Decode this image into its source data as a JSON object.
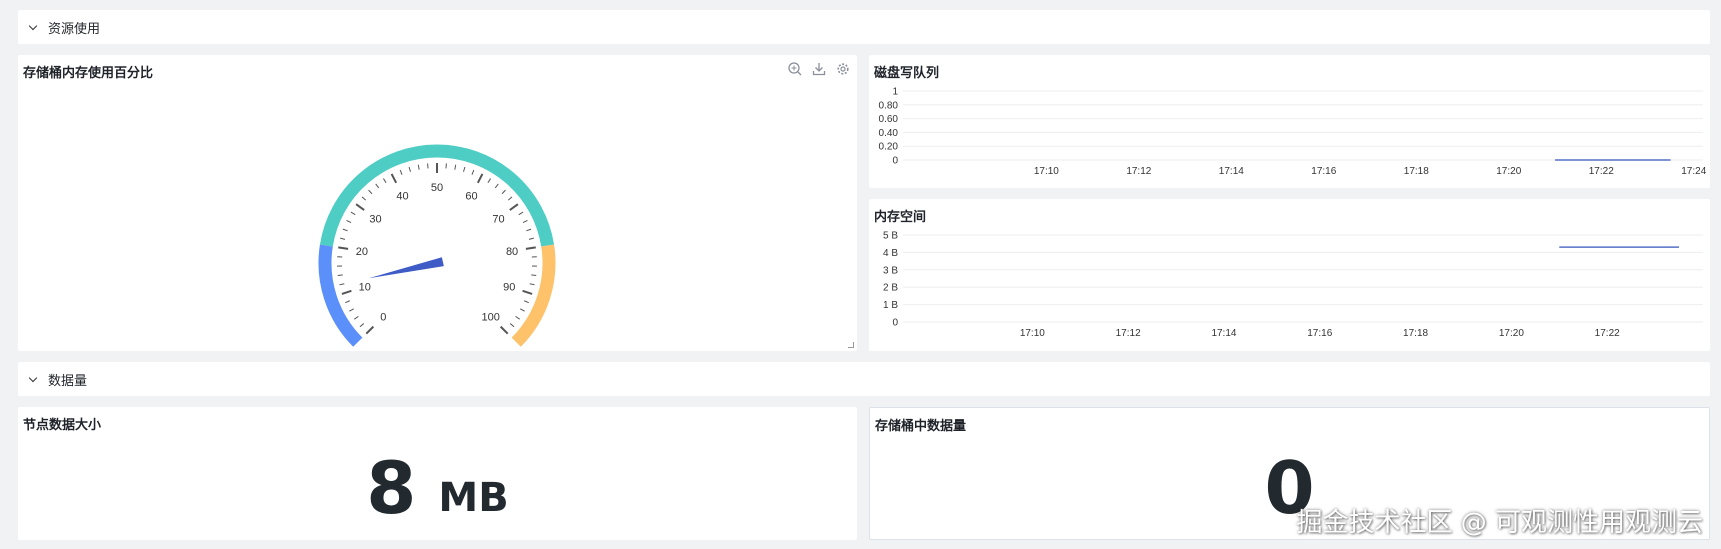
{
  "sections": {
    "resource_usage": "资源使用",
    "data_volume": "数据量"
  },
  "gauge_panel": {
    "title": "存储桶内存使用百分比",
    "value_percent": 12,
    "ticks": [
      "0",
      "10",
      "20",
      "30",
      "40",
      "50",
      "60",
      "70",
      "80",
      "90",
      "100"
    ],
    "colors": {
      "low": "#5b8ff9",
      "mid": "#4ecdc4",
      "high": "#fdc26a",
      "needle": "#3e5bc6"
    }
  },
  "disk_queue": {
    "title": "磁盘写队列",
    "chart_data": {
      "type": "line",
      "y_ticks": [
        "1",
        "0.80",
        "0.60",
        "0.40",
        "0.20",
        "0"
      ],
      "x_ticks": [
        "17:10",
        "17:12",
        "17:14",
        "17:16",
        "17:18",
        "17:20",
        "17:22",
        "17:24"
      ],
      "ylim": [
        0,
        1
      ],
      "series": [
        {
          "x": [
            "17:21",
            "17:23:30"
          ],
          "values": [
            0,
            0
          ]
        }
      ],
      "color": "#5470c6"
    }
  },
  "memory_space": {
    "title": "内存空间",
    "chart_data": {
      "type": "line",
      "y_ticks": [
        "5 B",
        "4 B",
        "3 B",
        "2 B",
        "1 B",
        "0"
      ],
      "x_ticks": [
        "17:10",
        "17:12",
        "17:14",
        "17:16",
        "17:18",
        "17:20",
        "17:22"
      ],
      "ylim": [
        0,
        5
      ],
      "series": [
        {
          "x": [
            "17:21",
            "17:23:30"
          ],
          "values": [
            4.3,
            4.3
          ]
        }
      ],
      "color": "#5470c6"
    }
  },
  "node_data_size": {
    "title": "节点数据大小",
    "value": "8",
    "unit": "MB"
  },
  "bucket_item_count": {
    "title": "存储桶中数据量",
    "value": "0"
  },
  "watermark": "掘金技术社区 @ 可观测性用观测云"
}
